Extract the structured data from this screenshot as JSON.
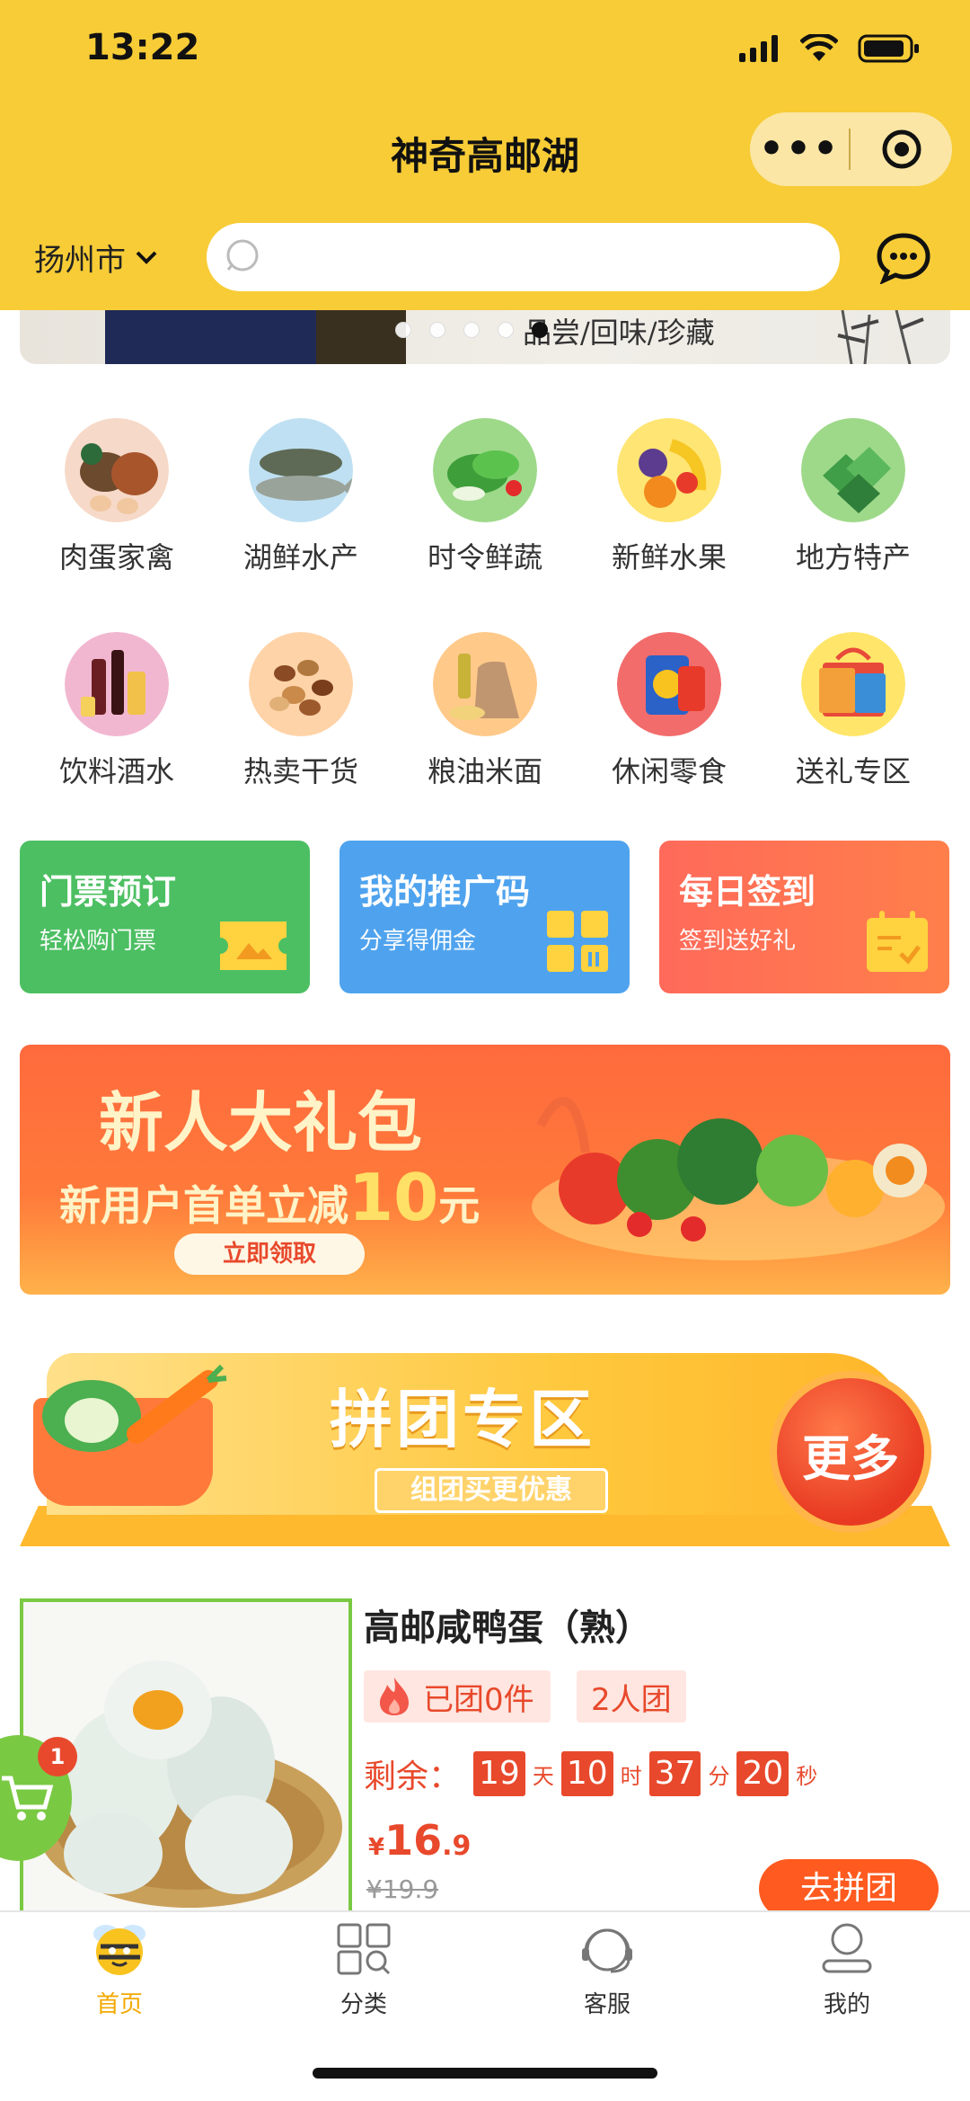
{
  "status_bar": {
    "time": "13:22"
  },
  "header": {
    "title": "神奇高邮湖",
    "capsule_more": "•••",
    "city": "扬州市",
    "search_placeholder": ""
  },
  "banner": {
    "slogan": "品尝/回味/珍藏",
    "dot_count": 5,
    "active_dot": 4
  },
  "categories": [
    {
      "label": "肉蛋家禽",
      "icon": "poultry-icon"
    },
    {
      "label": "湖鲜水产",
      "icon": "fish-icon"
    },
    {
      "label": "时令鲜蔬",
      "icon": "vegetable-icon"
    },
    {
      "label": "新鲜水果",
      "icon": "fruit-icon"
    },
    {
      "label": "地方特产",
      "icon": "specialty-icon"
    },
    {
      "label": "饮料酒水",
      "icon": "drinks-icon"
    },
    {
      "label": "热卖干货",
      "icon": "nuts-icon"
    },
    {
      "label": "粮油米面",
      "icon": "grain-icon"
    },
    {
      "label": "休闲零食",
      "icon": "snack-icon"
    },
    {
      "label": "送礼专区",
      "icon": "gift-icon"
    }
  ],
  "quick_cards": [
    {
      "title": "门票预订",
      "subtitle": "轻松购门票",
      "color": "#4CBF62"
    },
    {
      "title": "我的推广码",
      "subtitle": "分享得佣金",
      "color": "#4FA3EE"
    },
    {
      "title": "每日签到",
      "subtitle": "签到送好礼",
      "color": "#FF6A5A"
    }
  ],
  "promo": {
    "title": "新人大礼包",
    "line_prefix": "新用户首单立减",
    "amount": "10",
    "unit": "元",
    "button": "立即领取"
  },
  "group_banner": {
    "title": "拼团专区",
    "subtitle": "组团买更优惠",
    "more": "更多"
  },
  "product": {
    "name": "高邮咸鸭蛋（熟）",
    "joined": "已团0件",
    "group_size": "2人团",
    "remain_label": "剩余：",
    "days": "19",
    "days_unit": "天",
    "hours": "10",
    "hours_unit": "时",
    "minutes": "37",
    "minutes_unit": "分",
    "seconds": "20",
    "seconds_unit": "秒",
    "currency": "¥",
    "price_int": "16",
    "price_dec": ".9",
    "old_price": "¥19.9",
    "button": "去拼团"
  },
  "cart": {
    "badge": "1"
  },
  "tabbar": [
    {
      "label": "首页",
      "active": true
    },
    {
      "label": "分类",
      "active": false
    },
    {
      "label": "客服",
      "active": false
    },
    {
      "label": "我的",
      "active": false
    }
  ],
  "colors": {
    "brand_yellow": "#F7CC36",
    "accent_red": "#E8492C",
    "green": "#7AC943",
    "tab_active": "#F2A900"
  }
}
